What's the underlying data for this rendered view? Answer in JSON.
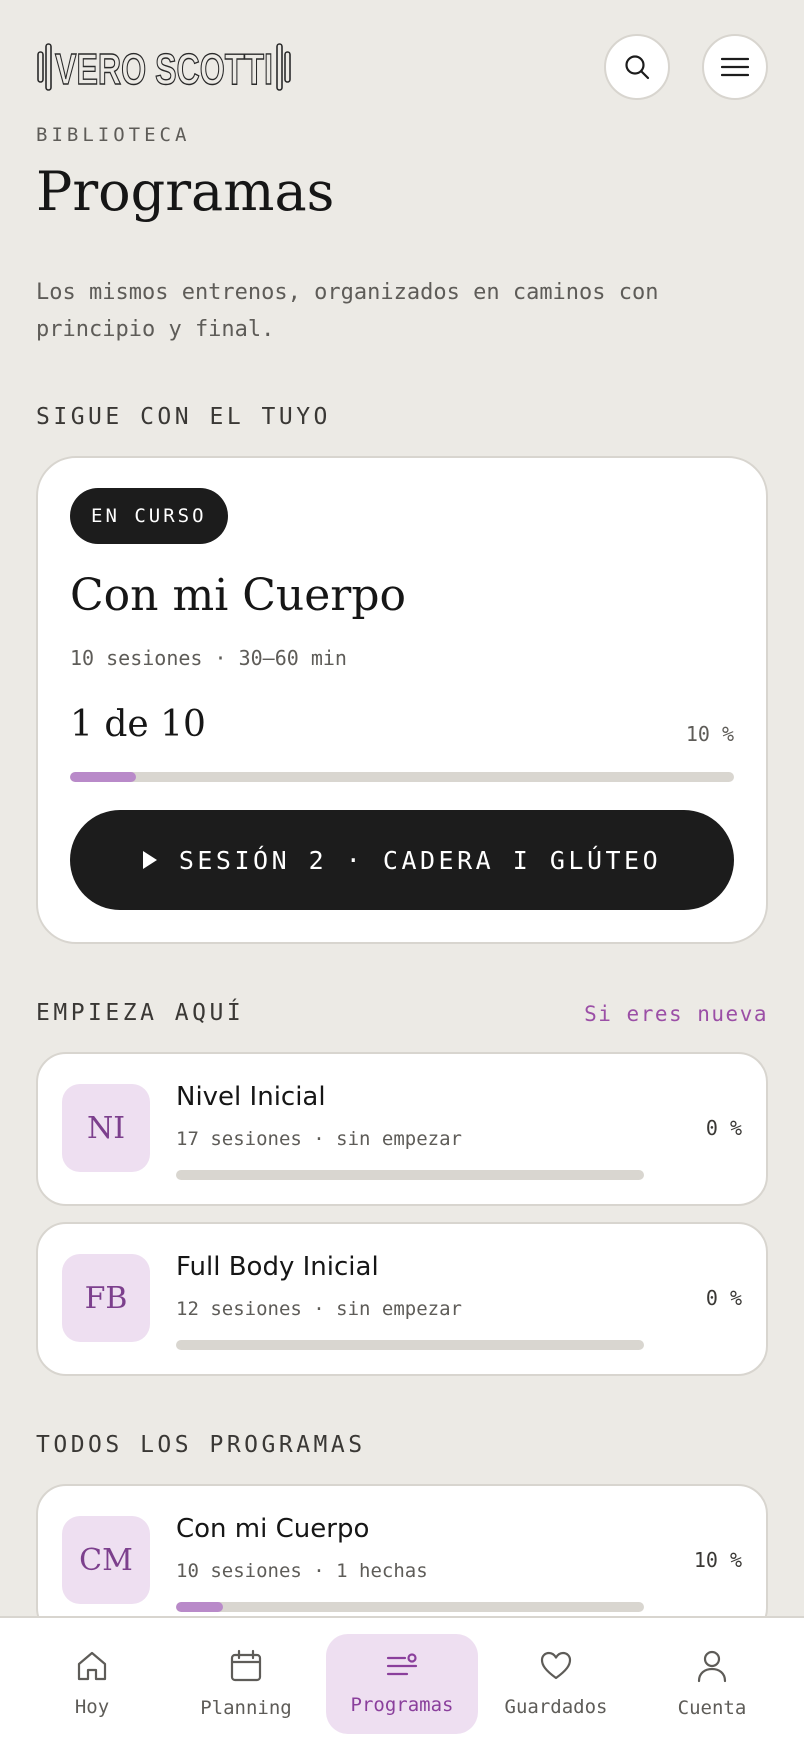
{
  "brand": {
    "logo_text": "VERO SCOTTI"
  },
  "header": {
    "eyebrow": "BIBLIOTECA",
    "title": "Programas",
    "intro": "Los mismos entrenos, organizados en caminos con principio y final."
  },
  "icons": {
    "search": "search-icon",
    "menu": "hamburger-icon"
  },
  "colors": {
    "background": "#ECEAE5",
    "accent": "#9B4FA6",
    "progress_fill": "#B98AC9",
    "avatar_bg": "#EEDFF1",
    "dark": "#1C1C1C"
  },
  "current": {
    "section_label": "SIGUE CON EL TUYO",
    "badge": "EN CURSO",
    "title": "Con mi Cuerpo",
    "meta": "10 sesiones · 30–60 min",
    "progress_text": "1 de 10",
    "percent_text": "10 %",
    "progress": 0.1,
    "cta_label": "SESIÓN 2 · CADERA I GLÚTEO"
  },
  "start_here": {
    "section_label": "EMPIEZA AQUÍ",
    "link": "Si eres nueva",
    "items": [
      {
        "initials": "NI",
        "title": "Nivel Inicial",
        "meta": "17 sesiones · sin empezar",
        "percent_text": "0 %",
        "progress": 0
      },
      {
        "initials": "FB",
        "title": "Full Body Inicial",
        "meta": "12 sesiones · sin empezar",
        "percent_text": "0 %",
        "progress": 0
      }
    ]
  },
  "all_programs": {
    "section_label": "TODOS LOS PROGRAMAS",
    "items": [
      {
        "initials": "CM",
        "title": "Con mi Cuerpo",
        "meta": "10 sesiones · 1 hechas",
        "percent_text": "10 %",
        "progress": 0.1
      }
    ]
  },
  "nav": {
    "items": [
      {
        "label": "Hoy",
        "icon": "home-icon"
      },
      {
        "label": "Planning",
        "icon": "calendar-icon"
      },
      {
        "label": "Programas",
        "icon": "programs-list-icon",
        "active": true
      },
      {
        "label": "Guardados",
        "icon": "heart-icon"
      },
      {
        "label": "Cuenta",
        "icon": "user-icon"
      }
    ]
  }
}
